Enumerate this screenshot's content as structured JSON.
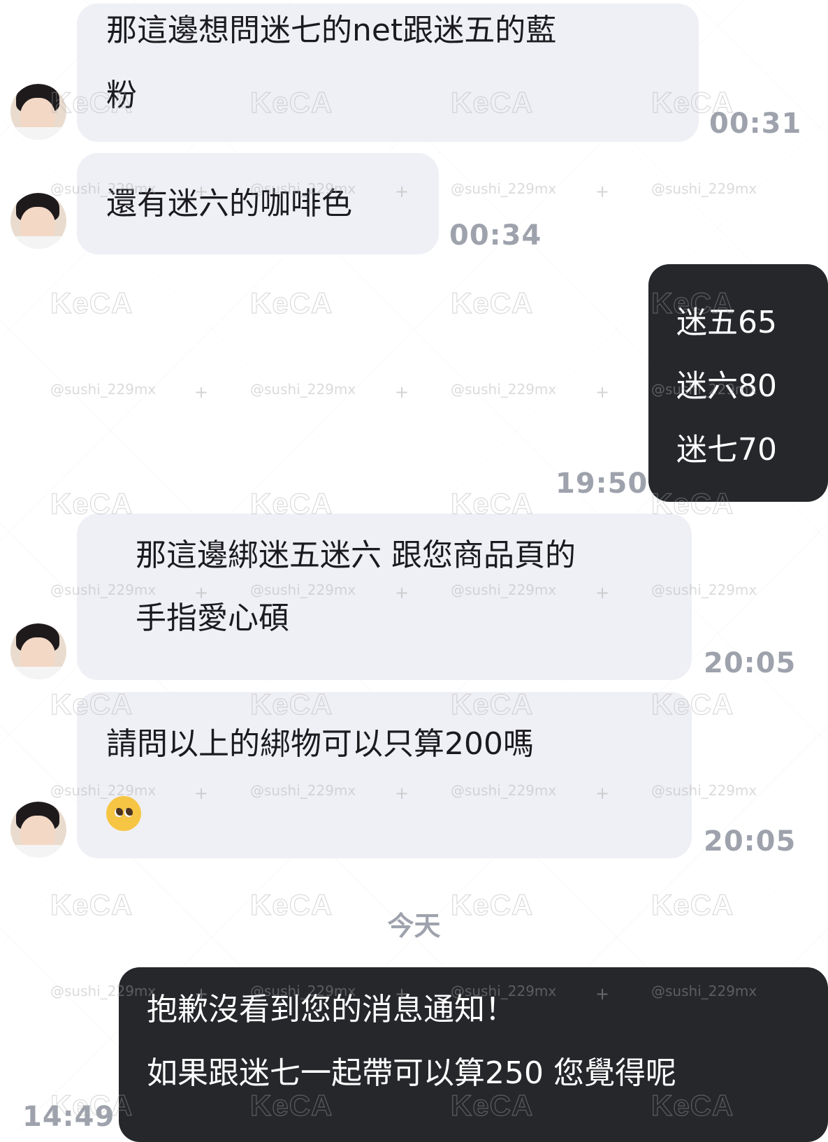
{
  "conversation": {
    "messages": [
      {
        "direction": "in",
        "lines": [
          "那這邊想問迷七的net跟迷五的藍",
          "粉"
        ],
        "time": "00:31"
      },
      {
        "direction": "in",
        "lines": [
          "還有迷六的咖啡色"
        ],
        "time": "00:34"
      },
      {
        "direction": "out",
        "lines": [
          "迷五65",
          "迷六80",
          "迷七70"
        ],
        "time": "19:50"
      },
      {
        "direction": "in",
        "lines": [
          "那這邊綁迷五迷六 跟您商品頁的",
          "手指愛心碩"
        ],
        "time": "20:05"
      },
      {
        "direction": "in",
        "lines": [
          "請問以上的綁物可以只算200嗎"
        ],
        "emoji": "pleading-face-emoji",
        "time": "20:05"
      },
      {
        "direction": "out",
        "lines": [
          "抱歉沒看到您的消息通知！",
          "如果跟迷七一起帶可以算250 您覺得呢"
        ],
        "time": "14:49"
      }
    ],
    "date_separator": "今天"
  },
  "watermark": {
    "logo": "KeCA",
    "handle": "@sushi_229mx"
  },
  "colors": {
    "incoming_bubble": "#eff0f5",
    "outgoing_bubble": "#25272b",
    "timestamp": "#9ea2ac"
  }
}
